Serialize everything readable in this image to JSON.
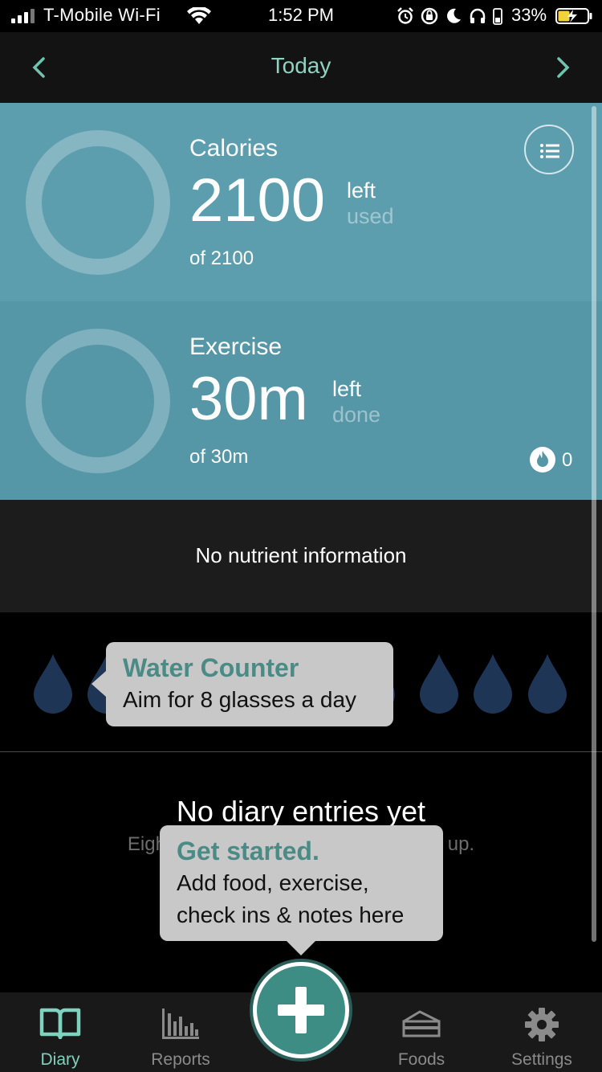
{
  "status_bar": {
    "carrier": "T-Mobile Wi-Fi",
    "time": "1:52 PM",
    "battery_percent": "33%"
  },
  "header": {
    "title": "Today",
    "prev_icon": "chevron-left-icon",
    "next_icon": "chevron-right-icon"
  },
  "calories": {
    "label": "Calories",
    "value": "2100",
    "left_label": "left",
    "used_label": "used",
    "of_text": "of 2100",
    "progress": 0
  },
  "exercise": {
    "label": "Exercise",
    "value": "30m",
    "left_label": "left",
    "done_label": "done",
    "of_text": "of 30m",
    "burn_count": "0",
    "progress": 0
  },
  "nutrients": {
    "text": "No nutrient information"
  },
  "water": {
    "glasses_total": 10,
    "glasses_filled": 0,
    "tooltip_title": "Water Counter",
    "tooltip_body": "Aim for 8 glasses a day"
  },
  "diary": {
    "empty_title": "No diary entries yet",
    "empty_subtitle": "Eighty percent of success is showing up.",
    "tooltip_title": "Get started.",
    "tooltip_line1": "Add food, exercise,",
    "tooltip_line2": "check ins & notes here"
  },
  "tabs": [
    {
      "label": "Diary",
      "icon": "book-icon",
      "active": true
    },
    {
      "label": "Reports",
      "icon": "bar-chart-icon",
      "active": false
    },
    {
      "label": "Foods",
      "icon": "cake-icon",
      "active": false
    },
    {
      "label": "Settings",
      "icon": "gear-icon",
      "active": false
    }
  ],
  "colors": {
    "accent": "#8fd3c0",
    "calories_panel": "#5c9eae",
    "exercise_panel": "#5596a7",
    "water_drop": "#1e3555",
    "add_button": "#3e8d84"
  }
}
